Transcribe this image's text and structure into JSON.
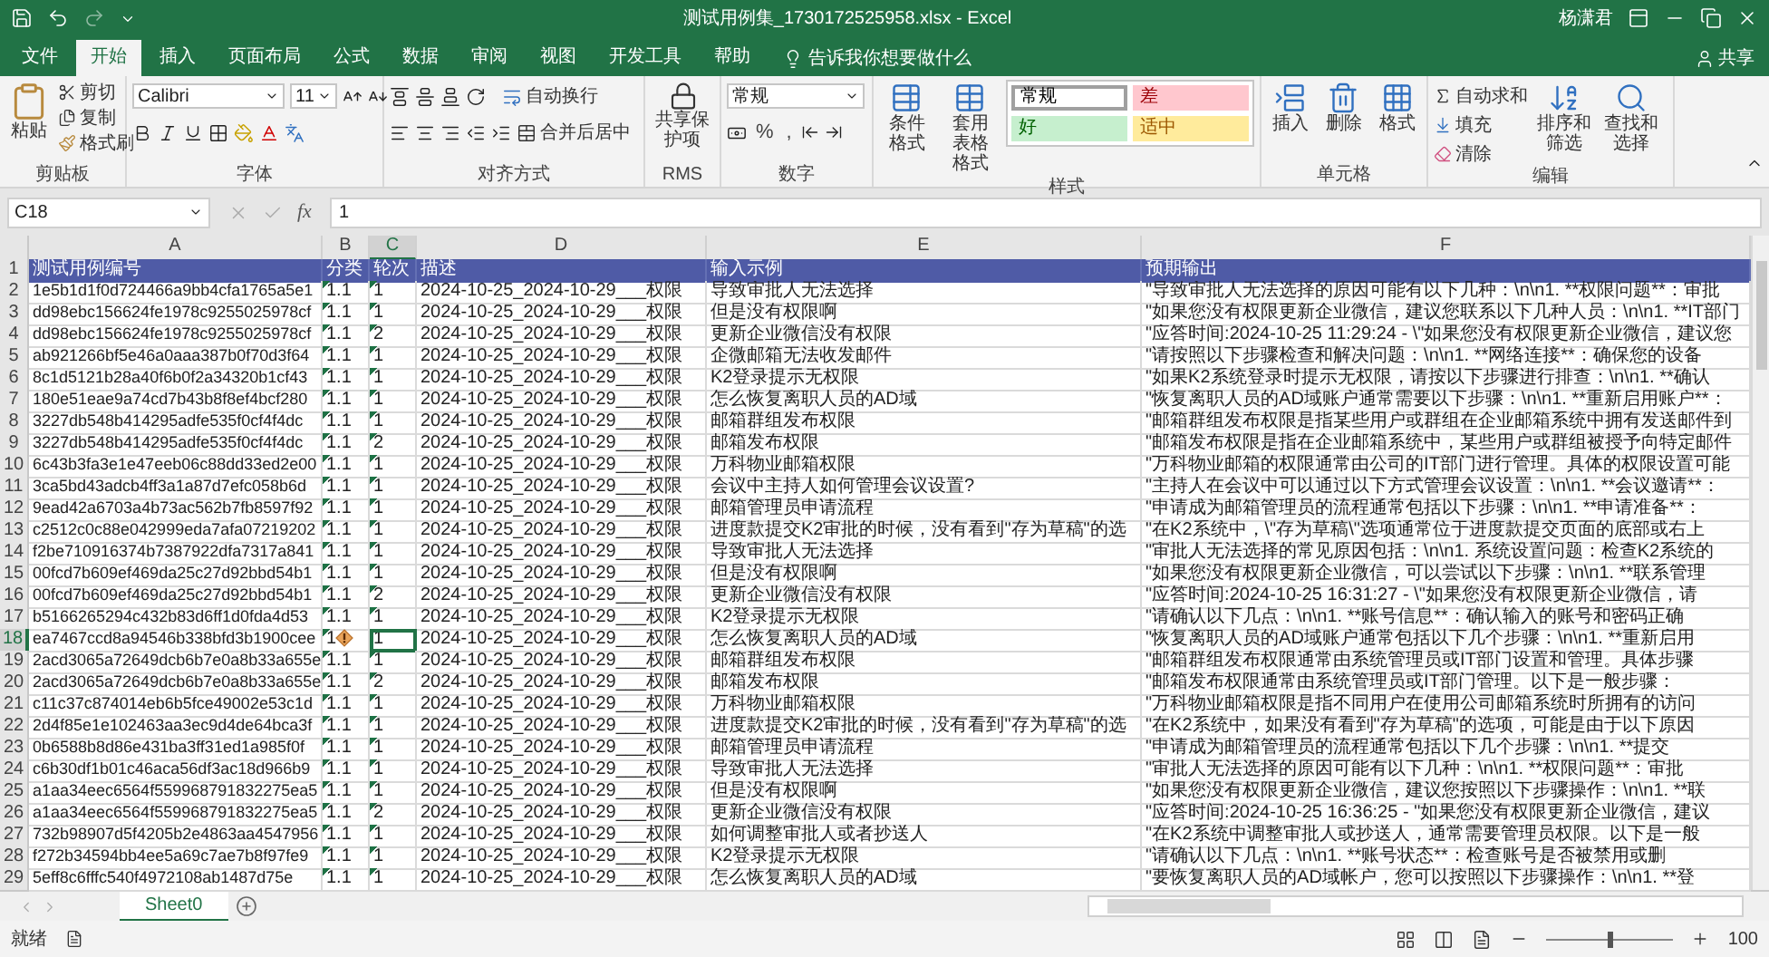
{
  "window": {
    "title": "测试用例集_1730172525958.xlsx  -  Excel",
    "user": "杨潇君"
  },
  "tabs": [
    {
      "label": "文件",
      "selected": false
    },
    {
      "label": "开始",
      "selected": true
    },
    {
      "label": "插入",
      "selected": false
    },
    {
      "label": "页面布局",
      "selected": false
    },
    {
      "label": "公式",
      "selected": false
    },
    {
      "label": "数据",
      "selected": false
    },
    {
      "label": "审阅",
      "selected": false
    },
    {
      "label": "视图",
      "selected": false
    },
    {
      "label": "开发工具",
      "selected": false
    },
    {
      "label": "帮助",
      "selected": false
    }
  ],
  "tell_me": "告诉我你想要做什么",
  "share": "共享",
  "ribbon": {
    "clipboard": {
      "label": "剪贴板",
      "paste": "粘贴",
      "cut": "剪切",
      "copy": "复制",
      "format_painter": "格式刷"
    },
    "font": {
      "label": "字体",
      "font_name": "Calibri",
      "font_size": "11"
    },
    "alignment": {
      "label": "对齐方式",
      "wrap": "自动换行",
      "merge": "合并后居中"
    },
    "rms": {
      "label": "RMS",
      "button": "共享保护项"
    },
    "number": {
      "label": "数字",
      "format": "常规",
      "percent": "%",
      "comma": ","
    },
    "styles": {
      "label": "样式",
      "conditional": "条件格式",
      "table_format": "套用表格格式",
      "cell_styles": [
        {
          "label": "常规",
          "kind": "normal",
          "selected": true
        },
        {
          "label": "差",
          "kind": "bad",
          "selected": false
        },
        {
          "label": "好",
          "kind": "good",
          "selected": false
        },
        {
          "label": "适中",
          "kind": "neutral",
          "selected": false
        }
      ]
    },
    "cells": {
      "label": "单元格",
      "buttons": [
        "插入",
        "删除",
        "格式"
      ]
    },
    "editing": {
      "label": "编辑",
      "autosum": "自动求和",
      "fill": "填充",
      "clear": "清除",
      "sort": "排序和筛选",
      "find": "查找和选择"
    }
  },
  "formula_bar": {
    "name_box": "C18",
    "fx": "fx",
    "value": "1"
  },
  "columns": [
    {
      "label": "A",
      "selected": false
    },
    {
      "label": "B",
      "selected": false
    },
    {
      "label": "C",
      "selected": true
    },
    {
      "label": "D",
      "selected": false
    },
    {
      "label": "E",
      "selected": false
    },
    {
      "label": "F",
      "selected": false
    }
  ],
  "header_row": {
    "row": "1",
    "cells": [
      "测试用例编号",
      "分类",
      "轮次",
      "描述",
      "输入示例",
      "预期输出"
    ]
  },
  "rows": [
    {
      "row": "2",
      "id": "1e5b1d1f0d724466a9bb4cfa1765a5e1",
      "category": "1.1",
      "round": "1",
      "description": "2024-10-25_2024-10-29___权限",
      "input": "导致审批人无法选择",
      "output": "\"导致审批人无法选择的原因可能有以下几种：\\n\\n1. **权限问题**：审批",
      "selected": false,
      "warning": false
    },
    {
      "row": "3",
      "id": "dd98ebc156624fe1978c9255025978cf",
      "category": "1.1",
      "round": "1",
      "description": "2024-10-25_2024-10-29___权限",
      "input": "但是没有权限啊",
      "output": "\"如果您没有权限更新企业微信，建议您联系以下几种人员：\\n\\n1. **IT部门",
      "selected": false,
      "warning": false
    },
    {
      "row": "4",
      "id": "dd98ebc156624fe1978c9255025978cf",
      "category": "1.1",
      "round": "2",
      "description": "2024-10-25_2024-10-29___权限",
      "input": "更新企业微信没有权限",
      "output": "\"应答时间:2024-10-25 11:29:24 - \\\"如果您没有权限更新企业微信，建议您",
      "selected": false,
      "warning": false
    },
    {
      "row": "5",
      "id": "ab921266bf5e46a0aaa387b0f70d3f64",
      "category": "1.1",
      "round": "1",
      "description": "2024-10-25_2024-10-29___权限",
      "input": "企微邮箱无法收发邮件",
      "output": "\"请按照以下步骤检查和解决问题：\\n\\n1. **网络连接**：确保您的设备",
      "selected": false,
      "warning": false
    },
    {
      "row": "6",
      "id": "8c1d5121b28a40f6b0f2a34320b1cf43",
      "category": "1.1",
      "round": "1",
      "description": "2024-10-25_2024-10-29___权限",
      "input": "K2登录提示无权限",
      "output": "\"如果K2系统登录时提示无权限，请按以下步骤进行排查：\\n\\n1. **确认",
      "selected": false,
      "warning": false
    },
    {
      "row": "7",
      "id": "180e51eae9a74cd7b43b8f8ef4bcf280",
      "category": "1.1",
      "round": "1",
      "description": "2024-10-25_2024-10-29___权限",
      "input": "怎么恢复离职人员的AD域",
      "output": "\"恢复离职人员的AD域账户通常需要以下步骤：\\n\\n1. **重新启用账户**：",
      "selected": false,
      "warning": false
    },
    {
      "row": "8",
      "id": "3227db548b414295adfe535f0cf4f4dc",
      "category": "1.1",
      "round": "1",
      "description": "2024-10-25_2024-10-29___权限",
      "input": "邮箱群组发布权限",
      "output": "\"邮箱群组发布权限是指某些用户或群组在企业邮箱系统中拥有发送邮件到",
      "selected": false,
      "warning": false
    },
    {
      "row": "9",
      "id": "3227db548b414295adfe535f0cf4f4dc",
      "category": "1.1",
      "round": "2",
      "description": "2024-10-25_2024-10-29___权限",
      "input": "邮箱发布权限",
      "output": "\"邮箱发布权限是指在企业邮箱系统中，某些用户或群组被授予向特定邮件",
      "selected": false,
      "warning": false
    },
    {
      "row": "10",
      "id": "6c43b3fa3e1e47eeb06c88dd33ed2e00",
      "category": "1.1",
      "round": "1",
      "description": "2024-10-25_2024-10-29___权限",
      "input": "万科物业邮箱权限",
      "output": "\"万科物业邮箱的权限通常由公司的IT部门进行管理。具体的权限设置可能",
      "selected": false,
      "warning": false
    },
    {
      "row": "11",
      "id": "3ca5bd43adcb4ff3a1a87d7efc058b6d",
      "category": "1.1",
      "round": "1",
      "description": "2024-10-25_2024-10-29___权限",
      "input": "会议中主持人如何管理会议设置?",
      "output": "\"主持人在会议中可以通过以下方式管理会议设置：\\n\\n1. **会议邀请**：",
      "selected": false,
      "warning": false
    },
    {
      "row": "12",
      "id": "9ead42a6703a4b73ac562b7fb8597f92",
      "category": "1.1",
      "round": "1",
      "description": "2024-10-25_2024-10-29___权限",
      "input": "邮箱管理员申请流程",
      "output": "\"申请成为邮箱管理员的流程通常包括以下步骤：\\n\\n1. **申请准备**：",
      "selected": false,
      "warning": false
    },
    {
      "row": "13",
      "id": "c2512c0c88e042999eda7afa07219202",
      "category": "1.1",
      "round": "1",
      "description": "2024-10-25_2024-10-29___权限",
      "input": "进度款提交K2审批的时候，没有看到\"存为草稿\"的选",
      "output": "\"在K2系统中，\\\"存为草稿\\\"选项通常位于进度款提交页面的底部或右上",
      "selected": false,
      "warning": false
    },
    {
      "row": "14",
      "id": "f2be710916374b7387922dfa7317a841",
      "category": "1.1",
      "round": "1",
      "description": "2024-10-25_2024-10-29___权限",
      "input": "导致审批人无法选择",
      "output": "\"审批人无法选择的常见原因包括：\\n\\n1. 系统设置问题：检查K2系统的",
      "selected": false,
      "warning": false
    },
    {
      "row": "15",
      "id": "00fcd7b609ef469da25c27d92bbd54b1",
      "category": "1.1",
      "round": "1",
      "description": "2024-10-25_2024-10-29___权限",
      "input": "但是没有权限啊",
      "output": "\"如果您没有权限更新企业微信，可以尝试以下步骤：\\n\\n1. **联系管理",
      "selected": false,
      "warning": false
    },
    {
      "row": "16",
      "id": "00fcd7b609ef469da25c27d92bbd54b1",
      "category": "1.1",
      "round": "2",
      "description": "2024-10-25_2024-10-29___权限",
      "input": "更新企业微信没有权限",
      "output": "\"应答时间:2024-10-25 16:31:27 - \\\"如果您没有权限更新企业微信，请",
      "selected": false,
      "warning": false
    },
    {
      "row": "17",
      "id": "b5166265294c432b83d6ff1d0fda4d53",
      "category": "1.1",
      "round": "1",
      "description": "2024-10-25_2024-10-29___权限",
      "input": "K2登录提示无权限",
      "output": "\"请确认以下几点：\\n\\n1. **账号信息**：确认输入的账号和密码正确",
      "selected": false,
      "warning": false
    },
    {
      "row": "18",
      "id": "ea7467ccd8a94546b338bfd3b1900cee",
      "category": "1",
      "round": "1",
      "description": "2024-10-25_2024-10-29___权限",
      "input": "怎么恢复离职人员的AD域",
      "output": "\"恢复离职人员的AD域账户通常包括以下几个步骤：\\n\\n1. **重新启用",
      "selected": true,
      "warning": true
    },
    {
      "row": "19",
      "id": "2acd3065a72649dcb6b7e0a8b33a655e",
      "category": "1.1",
      "round": "1",
      "description": "2024-10-25_2024-10-29___权限",
      "input": "邮箱群组发布权限",
      "output": "\"邮箱群组发布权限通常由系统管理员或IT部门设置和管理。具体步骤",
      "selected": false,
      "warning": false
    },
    {
      "row": "20",
      "id": "2acd3065a72649dcb6b7e0a8b33a655e",
      "category": "1.1",
      "round": "2",
      "description": "2024-10-25_2024-10-29___权限",
      "input": "邮箱发布权限",
      "output": "\"邮箱发布权限通常由系统管理员或IT部门管理。以下是一般步骤：",
      "selected": false,
      "warning": false
    },
    {
      "row": "21",
      "id": "c11c37c874014eb6b5fce49002e53c1d",
      "category": "1.1",
      "round": "1",
      "description": "2024-10-25_2024-10-29___权限",
      "input": "万科物业邮箱权限",
      "output": "\"万科物业邮箱权限是指不同用户在使用公司邮箱系统时所拥有的访问",
      "selected": false,
      "warning": false
    },
    {
      "row": "22",
      "id": "2d4f85e1e102463aa3ec9d4de64bca3f",
      "category": "1.1",
      "round": "1",
      "description": "2024-10-25_2024-10-29___权限",
      "input": "进度款提交K2审批的时候，没有看到\"存为草稿\"的选",
      "output": "\"在K2系统中，如果没有看到\"存为草稿\"的选项，可能是由于以下原因",
      "selected": false,
      "warning": false
    },
    {
      "row": "23",
      "id": "0b6588b8d86e431ba3ff31ed1a985f0f",
      "category": "1.1",
      "round": "1",
      "description": "2024-10-25_2024-10-29___权限",
      "input": "邮箱管理员申请流程",
      "output": "\"申请成为邮箱管理员的流程通常包括以下几个步骤：\\n\\n1. **提交",
      "selected": false,
      "warning": false
    },
    {
      "row": "24",
      "id": "c6b30df1b01c46aca56df3ac18d966b9",
      "category": "1.1",
      "round": "1",
      "description": "2024-10-25_2024-10-29___权限",
      "input": "导致审批人无法选择",
      "output": "\"审批人无法选择的原因可能有以下几种：\\n\\n1. **权限问题**：审批",
      "selected": false,
      "warning": false
    },
    {
      "row": "25",
      "id": "a1aa34eec6564f559968791832275ea5",
      "category": "1.1",
      "round": "1",
      "description": "2024-10-25_2024-10-29___权限",
      "input": "但是没有权限啊",
      "output": "\"如果您没有权限更新企业微信，建议您按照以下步骤操作：\\n\\n1. **联",
      "selected": false,
      "warning": false
    },
    {
      "row": "26",
      "id": "a1aa34eec6564f559968791832275ea5",
      "category": "1.1",
      "round": "2",
      "description": "2024-10-25_2024-10-29___权限",
      "input": "更新企业微信没有权限",
      "output": "\"应答时间:2024-10-25 16:36:25 - \"如果您没有权限更新企业微信，建议",
      "selected": false,
      "warning": false
    },
    {
      "row": "27",
      "id": "732b98907d5f4205b2e4863aa4547956",
      "category": "1.1",
      "round": "1",
      "description": "2024-10-25_2024-10-29___权限",
      "input": "如何调整审批人或者抄送人",
      "output": "\"在K2系统中调整审批人或抄送人，通常需要管理员权限。以下是一般",
      "selected": false,
      "warning": false
    },
    {
      "row": "28",
      "id": "f272b34594bb4ee5a69c7ae7b8f97fe9",
      "category": "1.1",
      "round": "1",
      "description": "2024-10-25_2024-10-29___权限",
      "input": "K2登录提示无权限",
      "output": "\"请确认以下几点：\\n\\n1. **账号状态**：检查账号是否被禁用或删",
      "selected": false,
      "warning": false
    },
    {
      "row": "29",
      "id": "5eff8c6fffc540f4972108ab1487d75e",
      "category": "1.1",
      "round": "1",
      "description": "2024-10-25_2024-10-29___权限",
      "input": "怎么恢复离职人员的AD域",
      "output": "\"要恢复离职人员的AD域帐户，您可以按照以下步骤操作：\\n\\n1. **登",
      "selected": false,
      "warning": false
    }
  ],
  "sheets": [
    {
      "label": "Sheet0",
      "selected": true
    }
  ],
  "status": {
    "text": "就绪",
    "zoom": "100",
    "zoom_slider": {
      "level": 0.5
    }
  }
}
